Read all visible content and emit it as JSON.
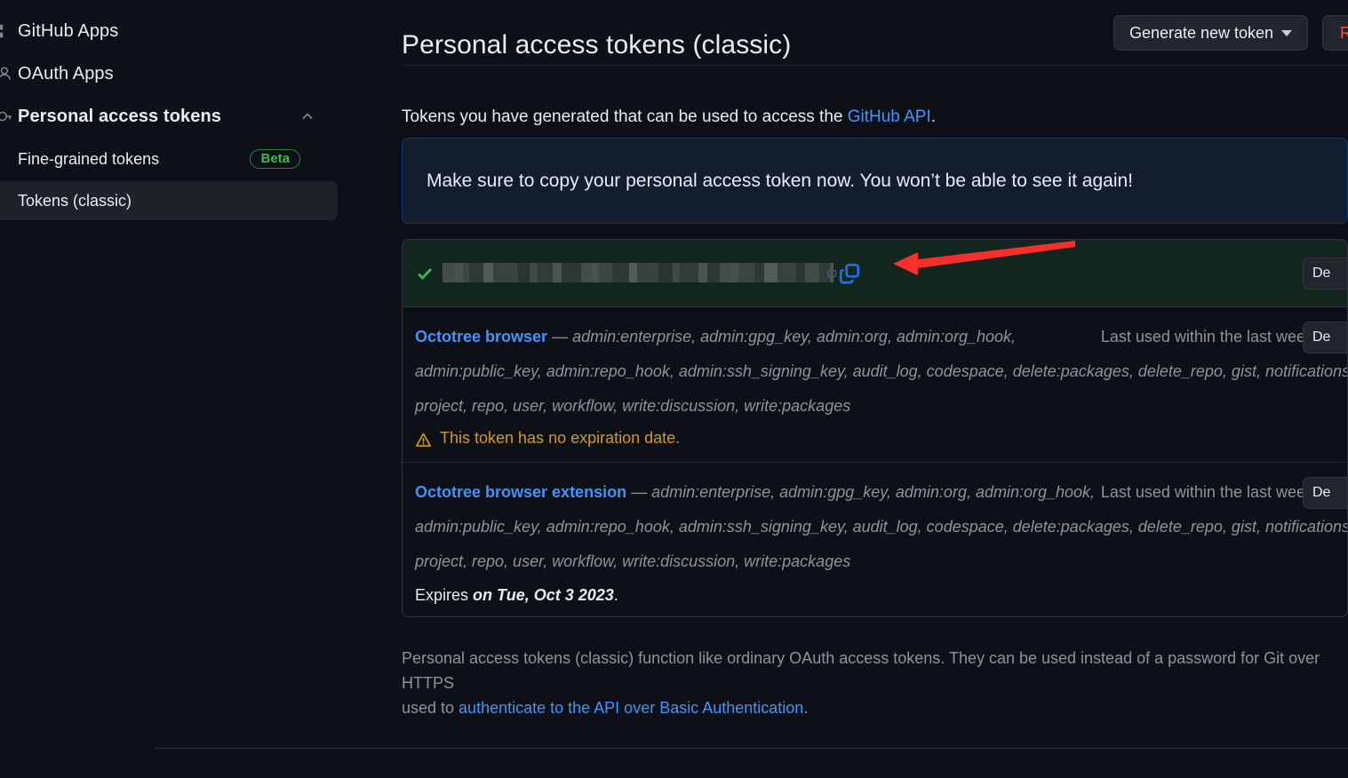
{
  "sidebar": {
    "items": [
      {
        "label": "GitHub Apps",
        "icon": "apps-icon"
      },
      {
        "label": "OAuth Apps",
        "icon": "person-icon"
      },
      {
        "label": "Personal access tokens",
        "icon": "key-icon"
      }
    ],
    "subitems": [
      {
        "label": "Fine-grained tokens",
        "badge": "Beta"
      },
      {
        "label": "Tokens (classic)"
      }
    ]
  },
  "header": {
    "title": "Personal access tokens (classic)",
    "generate_button": "Generate new token",
    "revoke_button": "Re"
  },
  "intro": {
    "text_before": "Tokens you have generated that can be used to access the ",
    "link": "GitHub API",
    "text_after": "."
  },
  "flash": {
    "message": "Make sure to copy your personal access token now. You won’t be able to see it again!"
  },
  "new_token_row": {
    "delete_label": "De"
  },
  "tokens": [
    {
      "name": "Octotree browser",
      "dash": " — ",
      "scopes_line1": "admin:enterprise, admin:gpg_key, admin:org, admin:org_hook,",
      "scopes_line2": "admin:public_key, admin:repo_hook, admin:ssh_signing_key, audit_log, codespace, delete:packages, delete_repo, gist, notifications,",
      "scopes_line3": "project, repo, user, workflow, write:discussion, write:packages",
      "last_used": "Last used within the last week",
      "delete_label": "De",
      "expiry_type": "warning",
      "expiry_text": "This token has no expiration date."
    },
    {
      "name": "Octotree browser extension",
      "dash": " — ",
      "scopes_line1": "admin:enterprise, admin:gpg_key, admin:org, admin:org_hook,",
      "scopes_line2": "admin:public_key, admin:repo_hook, admin:ssh_signing_key, audit_log, codespace, delete:packages, delete_repo, gist, notifications,",
      "scopes_line3": "project, repo, user, workflow, write:discussion, write:packages",
      "last_used": "Last used within the last week",
      "delete_label": "De",
      "expiry_type": "expires",
      "expiry_prefix": "Expires ",
      "expiry_date": "on Tue, Oct 3 2023",
      "expiry_suffix": "."
    }
  ],
  "footer": {
    "line1": "Personal access tokens (classic) function like ordinary OAuth access tokens. They can be used instead of a password for Git over HTTPS",
    "line2_before": "used to ",
    "line2_link": "authenticate to the API over Basic Authentication",
    "line2_after": "."
  },
  "colors": {
    "page_bg": "#0d1117",
    "accent_link": "#4493f8",
    "success_green": "#3fb950",
    "warning_amber": "#d29922",
    "danger_red": "#f85149",
    "annotation_red": "#f5302c",
    "copy_icon_blue": "#1f6feb"
  }
}
